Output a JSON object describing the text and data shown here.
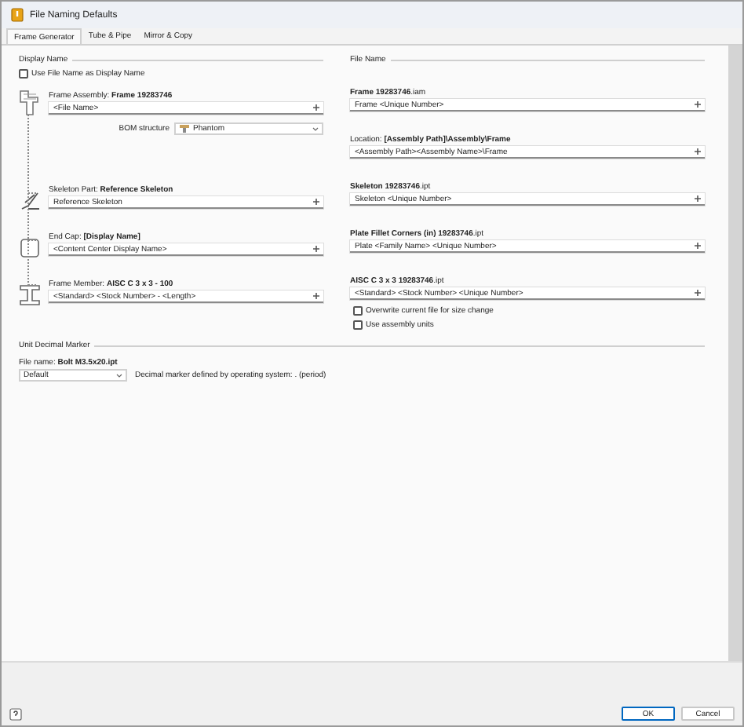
{
  "window": {
    "title": "File Naming Defaults"
  },
  "tabs": [
    {
      "label": "Frame Generator",
      "selected": true
    },
    {
      "label": "Tube & Pipe",
      "selected": false
    },
    {
      "label": "Mirror & Copy",
      "selected": false
    }
  ],
  "display_name": {
    "heading": "Display Name",
    "use_file_name": {
      "label": "Use File Name as Display Name",
      "checked": false
    },
    "items": [
      {
        "kind": "assembly",
        "label": "Frame Assembly: **Frame 19283746**",
        "value": "<File Name>"
      },
      {
        "kind": "skeleton",
        "label": "Skeleton Part: **Reference Skeleton**",
        "value": "Reference Skeleton"
      },
      {
        "kind": "endcap",
        "label": "End Cap: **[Display Name]**",
        "value": "<Content Center Display Name>"
      },
      {
        "kind": "member",
        "label": "Frame Member: **AISC C 3 x 3 - 100**",
        "value": "<Standard> <Stock Number> - <Length>"
      }
    ],
    "bom_structure": {
      "label": "BOM structure",
      "value": "Phantom"
    }
  },
  "file_name": {
    "heading": "File Name",
    "items": [
      {
        "label": "**Frame 19283746**.iam",
        "value": "Frame <Unique Number>"
      },
      {
        "label": "Location: **[Assembly Path]\\Assembly\\Frame**",
        "value": "<Assembly Path><Assembly Name>\\Frame"
      },
      {
        "label": "**Skeleton 19283746**.ipt",
        "value": "Skeleton <Unique Number>"
      },
      {
        "label": "**Plate Fillet Corners (in) 19283746**.ipt",
        "value": "Plate <Family Name> <Unique Number>"
      },
      {
        "label": "**AISC C 3 x 3 19283746**.ipt",
        "value": "<Standard> <Stock Number> <Unique Number>"
      }
    ],
    "options": [
      {
        "label": "Overwrite current file for size change",
        "checked": false
      },
      {
        "label": "Use assembly units",
        "checked": false
      }
    ]
  },
  "unit_decimal_marker": {
    "heading": "Unit Decimal Marker",
    "file_name": "File name: **Bolt M3.5x20.ipt**",
    "value": "Default",
    "note": "Decimal marker defined by operating system: . (period)"
  },
  "buttons": [
    {
      "label": "OK",
      "kind": "primary"
    },
    {
      "label": "Cancel",
      "kind": "secondary"
    }
  ]
}
